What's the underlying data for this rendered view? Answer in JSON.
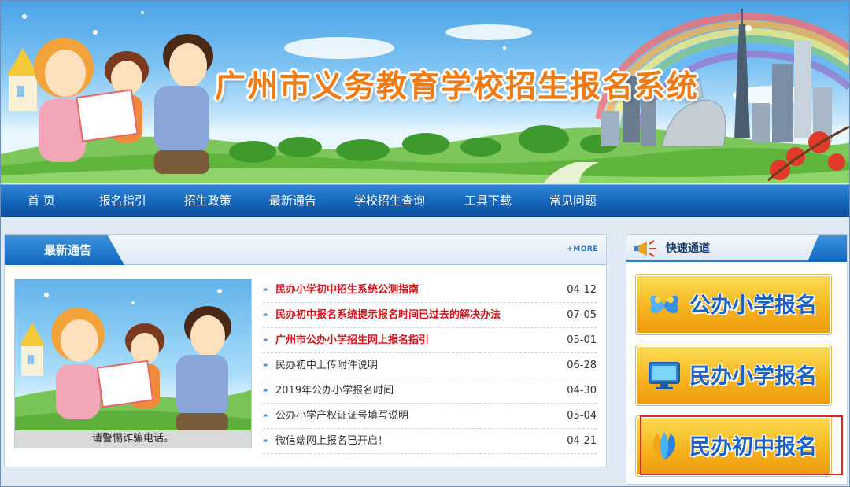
{
  "banner": {
    "title": "广州市义务教育学校招生报名系统"
  },
  "nav": {
    "items": [
      "首 页",
      "报名指引",
      "招生政策",
      "最新通告",
      "学校招生查询",
      "工具下载",
      "常见问题"
    ]
  },
  "notice_panel": {
    "title": "最新通告",
    "more_label": "+MORE",
    "photo_caption": "请警惕诈骗电话。",
    "items": [
      {
        "title": "民办小学初中招生系统公测指南",
        "date": "04-12",
        "hot": true
      },
      {
        "title": "民办初中报名系统提示报名时间已过去的解决办法",
        "date": "07-05",
        "hot": true
      },
      {
        "title": "广州市公办小学招生网上报名指引",
        "date": "05-01",
        "hot": true
      },
      {
        "title": "民办初中上传附件说明",
        "date": "06-28",
        "hot": false
      },
      {
        "title": "2019年公办小学报名时间",
        "date": "04-30",
        "hot": false
      },
      {
        "title": "公办小学产权证证号填写说明",
        "date": "05-04",
        "hot": false
      },
      {
        "title": "微信端网上报名已开启！",
        "date": "04-21",
        "hot": false
      }
    ]
  },
  "quick_access": {
    "title": "快速通道",
    "buttons": [
      {
        "label": "公办小学报名",
        "icon": "butterfly-icon"
      },
      {
        "label": "民办小学报名",
        "icon": "monitor-icon"
      },
      {
        "label": "民办初中报名",
        "icon": "leaf-logo-icon",
        "selected": true
      }
    ]
  },
  "colors": {
    "nav_blue": "#1565b9",
    "title_orange": "#f07a14",
    "hot_red": "#d8121c",
    "button_text_blue": "#1a62c6",
    "highlight_red": "#e0242b"
  }
}
